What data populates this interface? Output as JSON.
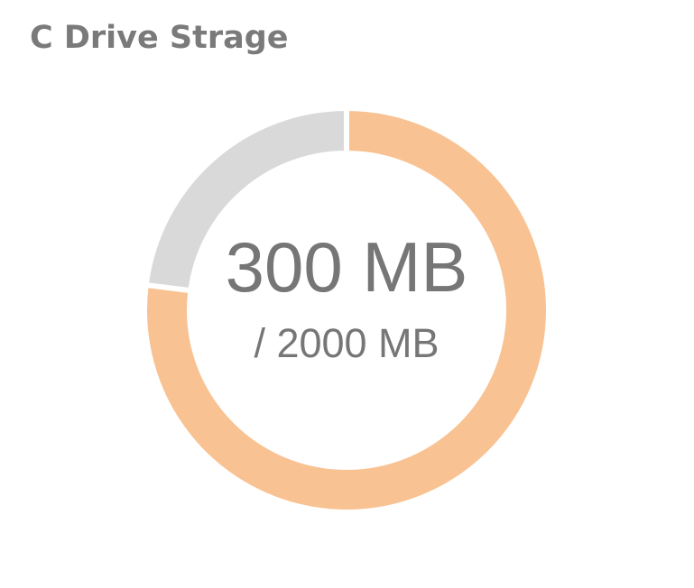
{
  "title": "C Drive Strage",
  "center": {
    "main": "300 MB",
    "sub": "/ 2000 MB"
  },
  "colors": {
    "primary": "#f9c292",
    "remainder": "#d9d9d9",
    "text": "#767676"
  },
  "chart_data": {
    "type": "donut",
    "title": "C Drive Strage",
    "slices": [
      {
        "value": 0.77,
        "color": "#f9c292"
      },
      {
        "value": 0.23,
        "color": "#d9d9d9"
      }
    ],
    "start_angle_deg": 0,
    "direction": "clockwise",
    "center_labels": [
      "300 MB",
      "/ 2000 MB"
    ]
  }
}
